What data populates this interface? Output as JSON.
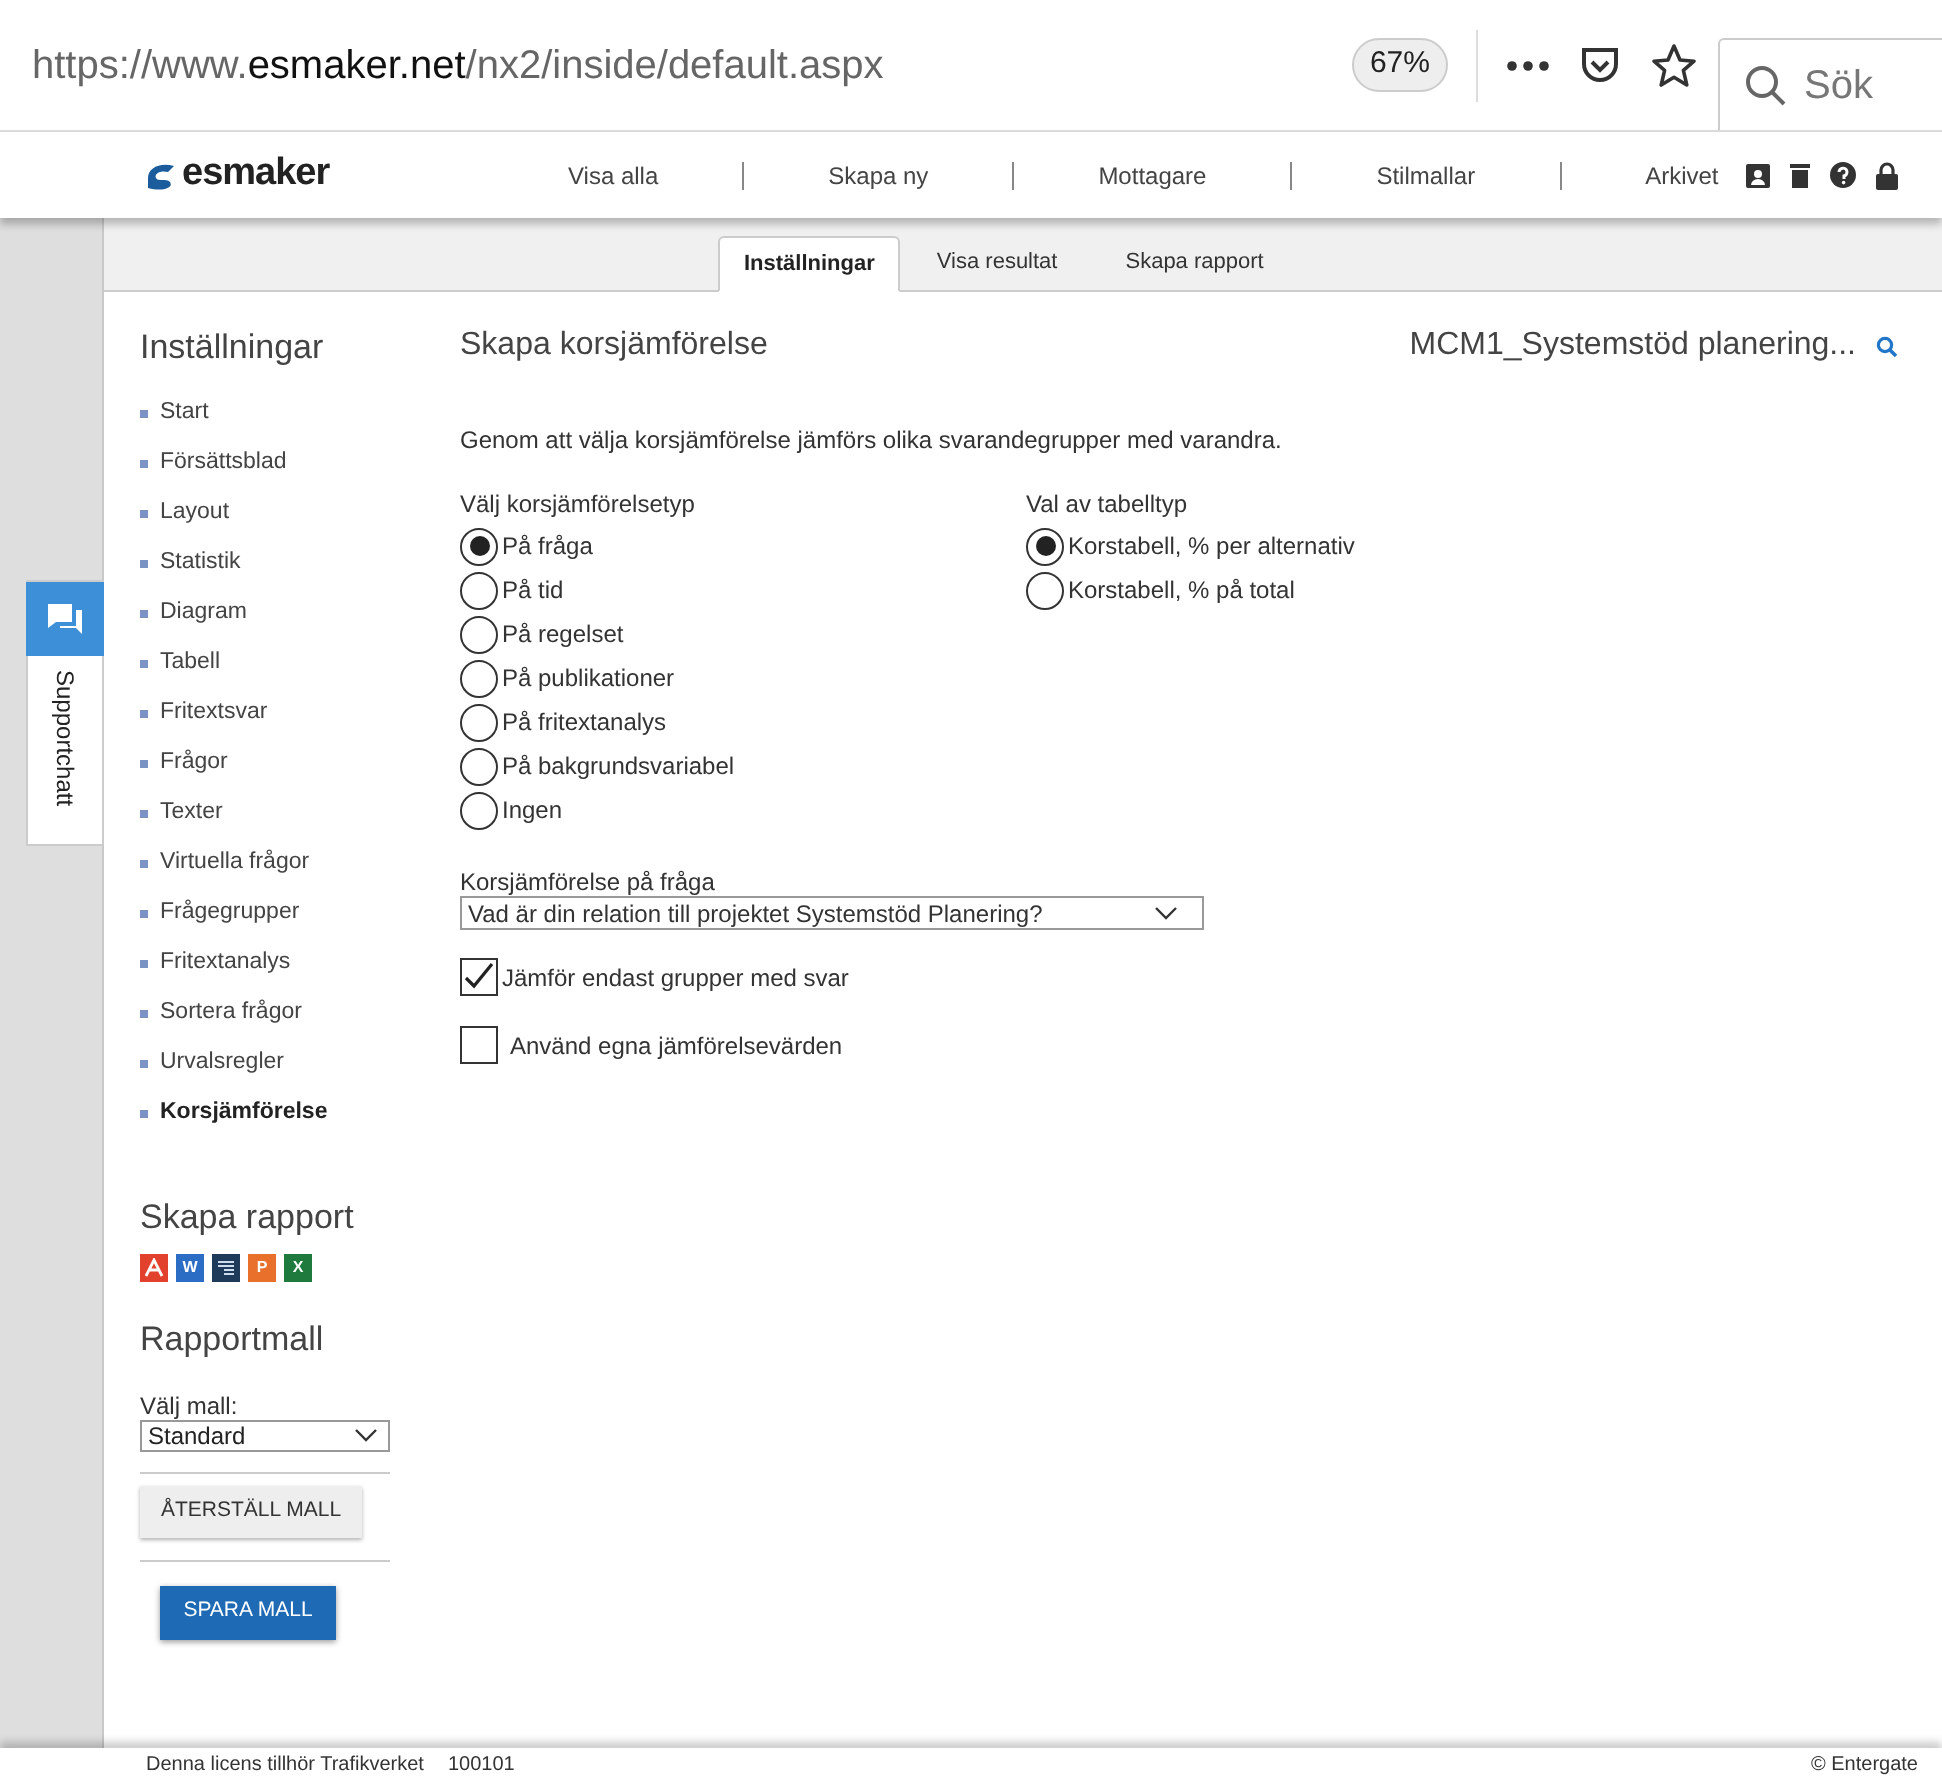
{
  "browser": {
    "url": {
      "prefix": "https://www.",
      "host": "esmaker.net",
      "path": "/nx2/inside/default.aspx"
    },
    "zoom": "67%",
    "search": {
      "placeholder": "Sök"
    }
  },
  "header": {
    "logo": "esmaker",
    "nav": [
      "Visa alla",
      "Skapa ny",
      "Mottagare",
      "Stilmallar",
      "Arkivet"
    ]
  },
  "tabs": [
    {
      "label": "Inställningar",
      "selected": true
    },
    {
      "label": "Visa resultat",
      "selected": false
    },
    {
      "label": "Skapa rapport",
      "selected": false
    }
  ],
  "support_chat": {
    "label": "Supportchatt"
  },
  "sidebar": {
    "title": "Inställningar",
    "items": [
      {
        "label": "Start",
        "selected": false
      },
      {
        "label": "Försättsblad",
        "selected": false
      },
      {
        "label": "Layout",
        "selected": false
      },
      {
        "label": "Statistik",
        "selected": false
      },
      {
        "label": "Diagram",
        "selected": false
      },
      {
        "label": "Tabell",
        "selected": false
      },
      {
        "label": "Fritextsvar",
        "selected": false
      },
      {
        "label": "Frågor",
        "selected": false
      },
      {
        "label": "Texter",
        "selected": false
      },
      {
        "label": "Virtuella frågor",
        "selected": false
      },
      {
        "label": "Frågegrupper",
        "selected": false
      },
      {
        "label": "Fritextanalys",
        "selected": false
      },
      {
        "label": "Sortera frågor",
        "selected": false
      },
      {
        "label": "Urvalsregler",
        "selected": false
      },
      {
        "label": "Korsjämförelse",
        "selected": true
      }
    ],
    "report_title": "Skapa rapport",
    "exports": [
      {
        "kind": "pdf",
        "color": "#e2412d"
      },
      {
        "kind": "word",
        "label": "W",
        "color": "#2b6cc4"
      },
      {
        "kind": "publisher",
        "color": "#1f3b5a"
      },
      {
        "kind": "powerpoint",
        "label": "P",
        "color": "#e8702a"
      },
      {
        "kind": "excel",
        "label": "X",
        "color": "#1e7b3d"
      }
    ],
    "template_title": "Rapportmall",
    "template_label": "Välj mall:",
    "template_value": "Standard",
    "reset_button": "ÅTERSTÄLL MALL",
    "save_button": "SPARA MALL"
  },
  "main": {
    "title": "Skapa korsjämförelse",
    "survey": "MCM1_Systemstöd planering...",
    "intro": "Genom att välja korsjämförelse jämförs olika svarandegrupper med varandra.",
    "compare_type": {
      "label": "Välj korsjämförelsetyp",
      "options": [
        {
          "label": "På fråga",
          "selected": true
        },
        {
          "label": "På tid",
          "selected": false
        },
        {
          "label": "På regelset",
          "selected": false
        },
        {
          "label": "På publikationer",
          "selected": false
        },
        {
          "label": "På fritextanalys",
          "selected": false
        },
        {
          "label": "På bakgrundsvariabel",
          "selected": false
        },
        {
          "label": "Ingen",
          "selected": false
        }
      ]
    },
    "table_type": {
      "label": "Val av tabelltyp",
      "options": [
        {
          "label": "Korstabell, % per alternativ",
          "selected": true
        },
        {
          "label": "Korstabell, % på total",
          "selected": false
        }
      ]
    },
    "question": {
      "label": "Korsjämförelse på fråga",
      "value": "Vad är din relation till projektet Systemstöd Planering?"
    },
    "checkboxes": [
      {
        "label": "Jämför endast grupper med svar",
        "checked": true
      },
      {
        "label": "Använd egna jämförelsevärden",
        "checked": false
      }
    ]
  },
  "footer": {
    "license": "Denna licens tillhör Trafikverket",
    "number": "100101",
    "copyright": "© Entergate"
  }
}
